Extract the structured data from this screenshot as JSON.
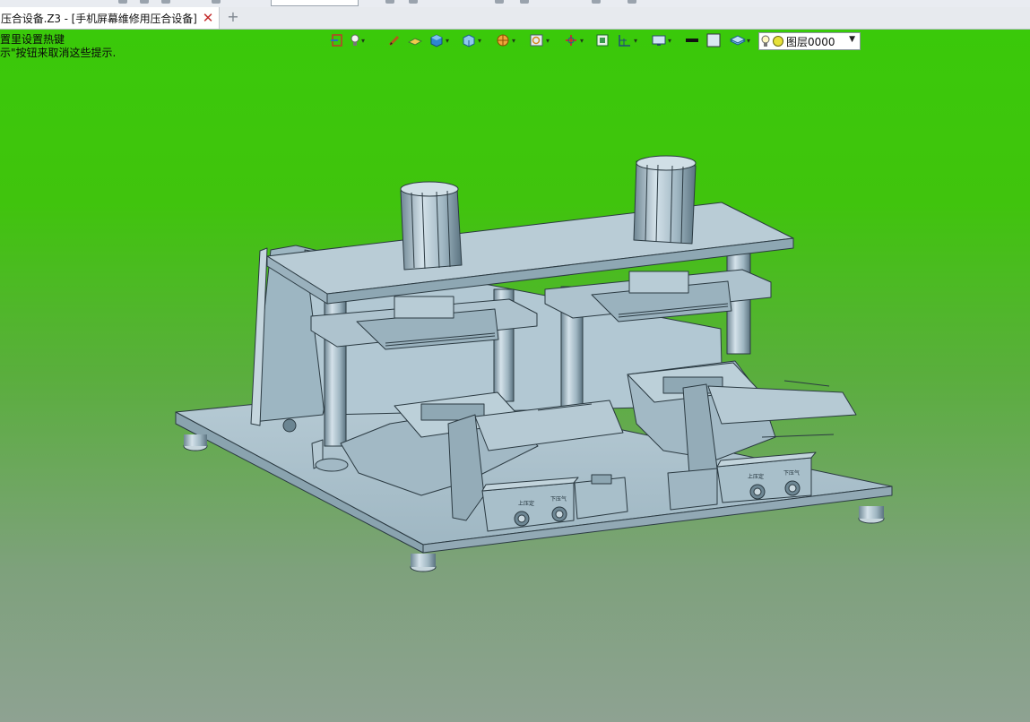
{
  "document_tab": {
    "title": "压合设备.Z3 - [手机屏幕维修用压合设备]",
    "close_icon": "close-icon"
  },
  "new_tab": {
    "label": "+"
  },
  "hints": {
    "line1": "置里设置热键",
    "line2": "示\"按钮来取消这些提示."
  },
  "view_toolbar": {
    "icons": [
      "exit-view-icon",
      "light-bulb-icon",
      "pen-icon",
      "face-color-icon",
      "shaded-cube-icon",
      "view-cube-icon",
      "render-mode-icon",
      "zoom-icon",
      "rotate-icon",
      "fit-icon",
      "grid-icon",
      "monitor-icon",
      "line-style-icon",
      "color-icon",
      "layer-icon"
    ],
    "layer": {
      "value": "图层0000",
      "icons": [
        "light-bulb-icon",
        "yellow-circle-icon"
      ]
    }
  },
  "viewport": {
    "background_top": "#3ac90a",
    "background_bottom": "#8ea292",
    "model_color": "#a7c0cc"
  },
  "model": {
    "control_box_1": {
      "left_label": "上压定",
      "right_label": "下压气"
    },
    "control_box_2": {
      "left_label": "上压定",
      "right_label": "下压气"
    }
  }
}
